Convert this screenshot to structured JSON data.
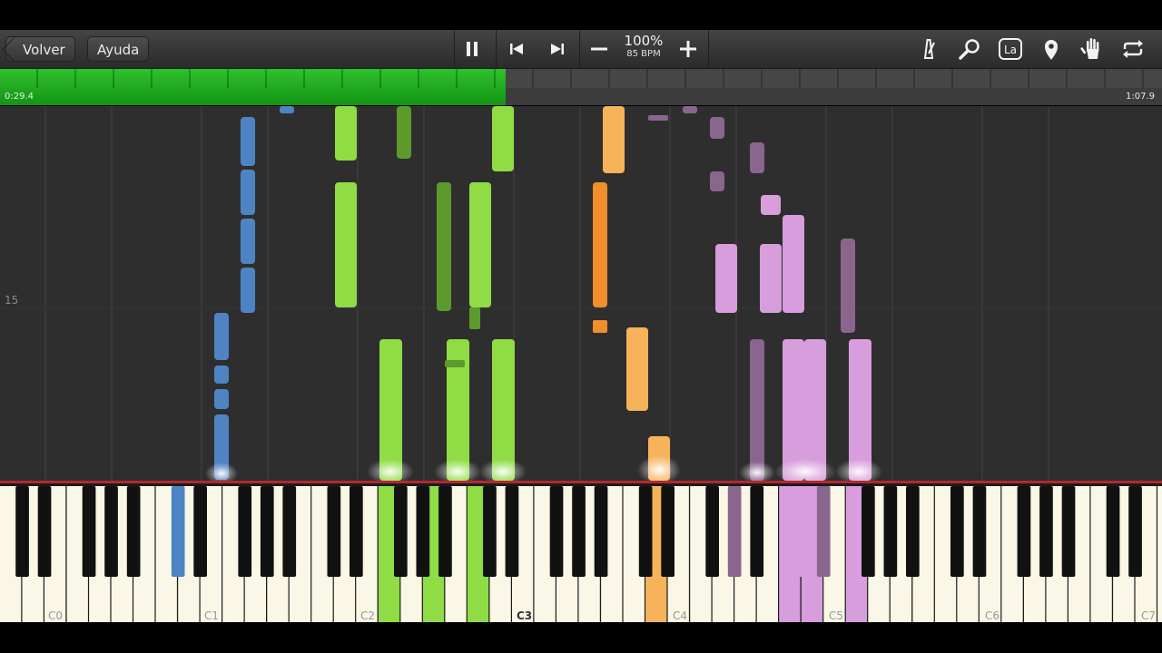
{
  "toolbar": {
    "back_label": "Volver",
    "help_label": "Ayuda",
    "zoom_percent": "100%",
    "tempo": "85 BPM",
    "icons": [
      "pause-icon",
      "skip-back-icon",
      "skip-forward-icon",
      "minus-icon",
      "plus-icon",
      "metronome-icon",
      "search-icon",
      "key-label-icon",
      "location-pin-icon",
      "hand-icon",
      "loop-icon"
    ],
    "key_label_text": "La"
  },
  "timeline": {
    "current_time": "0:29.4",
    "total_time": "1:07.9",
    "progress": 0.435
  },
  "roll": {
    "measure_number": "15"
  },
  "keyboard": {
    "octave_labels": [
      "C0",
      "C1",
      "C2",
      "C3",
      "C4",
      "C5",
      "C6",
      "C7"
    ],
    "current_octave": "C3"
  },
  "colors": {
    "background": "#2e2e2e",
    "progress": "#22b122",
    "blue_notes": "#4f84c4",
    "green_notes": "#8fdc45",
    "dark_green_notes": "#5c9a2c",
    "orange_notes": "#f6b35a",
    "dark_orange_notes": "#f08f2c",
    "pink_notes": "#d79ddc",
    "dark_pink_notes": "#8a668e",
    "keyboard_border": "#b7262e"
  }
}
